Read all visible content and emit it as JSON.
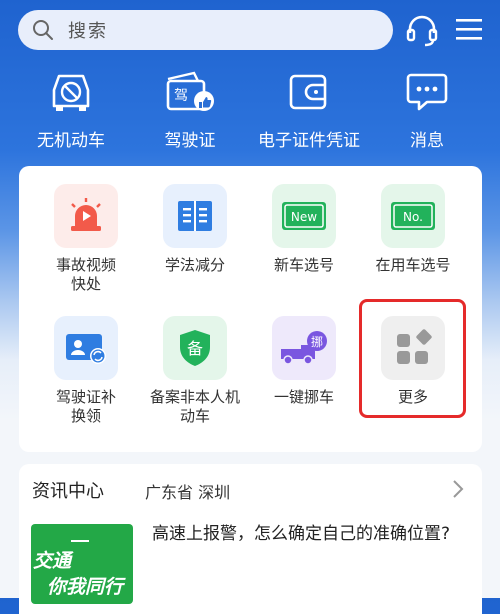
{
  "search": {
    "placeholder": "搜索"
  },
  "quick_actions": [
    {
      "label": "无机动车",
      "icon": "car-block-icon"
    },
    {
      "label": "驾驶证",
      "icon": "license-like-icon"
    },
    {
      "label": "电子证件凭证",
      "icon": "wallet-icon"
    },
    {
      "label": "消息",
      "icon": "message-icon"
    }
  ],
  "services": [
    {
      "label": "事故视频快处",
      "icon": "alarm-light-icon",
      "color": "#f25a4a"
    },
    {
      "label": "学法减分",
      "icon": "book-icon",
      "color": "#2f7de1"
    },
    {
      "label": "新车选号",
      "icon": "new-plate-icon",
      "color": "#22b25b"
    },
    {
      "label": "在用车选号",
      "icon": "number-plate-icon",
      "color": "#22b25b"
    },
    {
      "label": "驾驶证补换领",
      "icon": "id-card-refresh-icon",
      "color": "#2f7de1"
    },
    {
      "label": "备案非本人机动车",
      "icon": "shield-record-icon",
      "color": "#22b25b"
    },
    {
      "label": "一键挪车",
      "icon": "tow-truck-icon",
      "color": "#7a56e0"
    },
    {
      "label": "更多",
      "icon": "more-grid-icon",
      "color": "#9a9a9a"
    }
  ],
  "news": {
    "title": "资讯中心",
    "location": "广东省 深圳",
    "headline": "高速上报警，怎么确定自己的准确位置?",
    "thumb_text_1": "交通",
    "thumb_text_2": "你我同行"
  }
}
